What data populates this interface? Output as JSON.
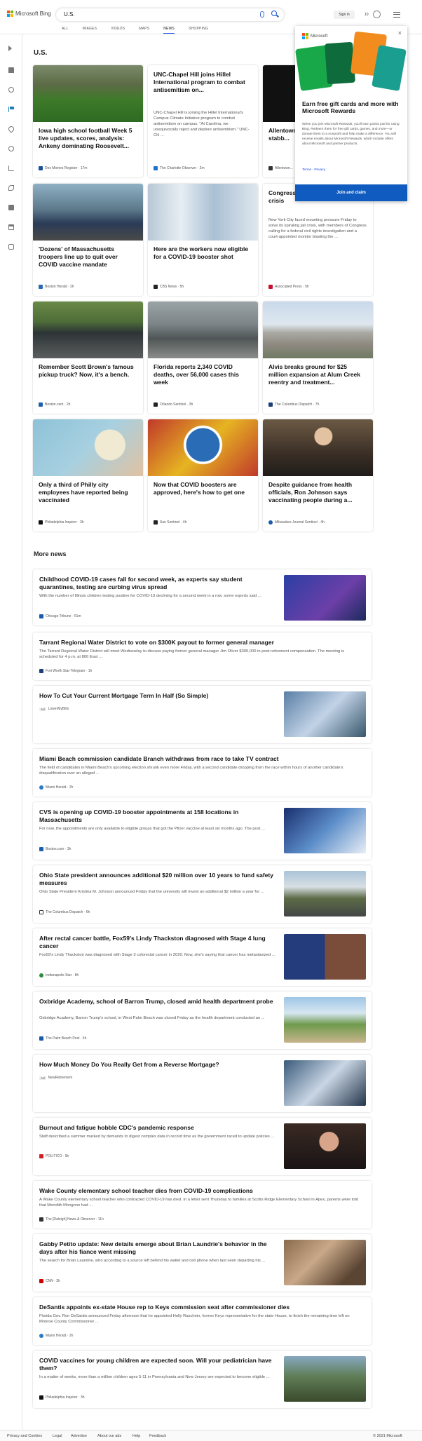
{
  "header": {
    "logo_text": "Microsoft Bing",
    "query": "U.S.",
    "signin": "Sign in",
    "points": "10"
  },
  "tabs": [
    "ALL",
    "IMAGES",
    "VIDEOS",
    "MAPS",
    "NEWS",
    "SHOPPING"
  ],
  "section_title": "U.S.",
  "popup": {
    "brand": "Microsoft",
    "close": "×",
    "heading": "Earn free gift cards and more with Microsoft Rewards",
    "body": "When you join Microsoft Rewards, you'll earn points just for using Bing. Redeem them for free gift cards, games, and more—or donate them to a nonprofit and help make a difference. You will receive emails about Microsoft Rewards, which include offers about Microsoft and partner products.",
    "terms": "Terms · Privacy",
    "button": "Join and claim"
  },
  "cards": [
    {
      "title": "Iowa high school football Week 5 live updates, scores, analysis: Ankeny dominating Roosevelt...",
      "source": "Des Moines Register · 17m"
    },
    {
      "title": "UNC-Chapel Hill joins Hillel International program to combat antisemitism on...",
      "desc": "UNC-Chapel Hill is joining the Hillel International's Campus Climate Initiative program to combat antisemitism on campus. \"At Carolina, we unequivocally reject and deplore antisemitism,\" UNC-CH ...",
      "source": "The Charlotte Observer · 2m"
    },
    {
      "title": "Allentown ... more tha... for stabb...",
      "source": "Allentown..."
    },
    {
      "title": "'Dozens' of Massachusetts troopers line up to quit over COVID vaccine mandate",
      "source": "Boston Herald · 2h"
    },
    {
      "title": "Here are the workers now eligible for a COVID-19 booster shot",
      "source": "CBS News · 5h"
    },
    {
      "title": "Congress ... York City to fix jails crisis",
      "desc": "New York City faced mounting pressure Friday to solve its spiraling jail crisis, with members of Congress calling for a federal civil rights investigation and a court-appointed monitor blasting the ...",
      "source": "Associated Press · 5h"
    },
    {
      "title": "Remember Scott Brown's famous pickup truck? Now, it's a bench.",
      "source": "Boston.com · 2h"
    },
    {
      "title": "Florida reports 2,340 COVID deaths, over 56,000 cases this week",
      "source": "Orlando Sentinel · 3h"
    },
    {
      "title": "Alvis breaks ground for $25 million expansion at Alum Creek reentry and treatment...",
      "source": "The Columbus Dispatch · 7h"
    },
    {
      "title": "Only a third of Philly city employees have reported being vaccinated",
      "source": "Philadelphia Inquirer · 3h"
    },
    {
      "title": "Now that COVID boosters are approved, here's how to get one",
      "source": "Sun Sentinel · 4h"
    },
    {
      "title": "Despite guidance from health officials, Ron Johnson says vaccinating people during a...",
      "source": "Milwaukee Journal Sentinel · 4h"
    }
  ],
  "more_news_title": "More news",
  "more_news": [
    {
      "title": "Childhood COVID-19 cases fall for second week, as experts say student quarantines, testing are curbing virus spread",
      "desc": "With the number of Illinois children testing positive for COVID-19 declining for a second week in a row, some experts said ...",
      "source": "Chicago Tribune · 51m"
    },
    {
      "title": "Tarrant Regional Water District to vote on $300K payout to former general manager",
      "desc": "The Tarrant Regional Water District will meet Wednesday to discuss paying former general manager Jim Oliver $300,000 in post-retirement compensation. The meeting is scheduled for 4 p.m. at 800 East ...",
      "source": "Fort Worth Star-Telegram · 1h"
    },
    {
      "title": "How To Cut Your Current Mortgage Term In Half (So Simple)",
      "ad": "Ad",
      "source": "LowerMyBills"
    },
    {
      "title": "Miami Beach commission candidate Branch withdraws from race to take TV contract",
      "desc": "The field of candidates in Miami Beach's upcoming election shrunk even more Friday, with a second candidate dropping from the race within hours of another candidate's disqualification over an alleged ...",
      "source": "Miami Herald · 2h"
    },
    {
      "title": "CVS is opening up COVID-19 booster appointments at 158 locations in Massachusetts",
      "desc": "For now, the appointments are only available to eligible groups that got the Pfizer vaccine at least six months ago. The post ...",
      "source": "Boston.com · 3h"
    },
    {
      "title": "Ohio State president announces additional $20 million over 10 years to fund safety measures",
      "desc": "Ohio State President Kristina M. Johnson announced Friday that the university will invest an additional $2 million a year for ...",
      "source": "The Columbus Dispatch · 6h"
    },
    {
      "title": "After rectal cancer battle, Fox59's Lindy Thackston diagnosed with Stage 4 lung cancer",
      "desc": "Fox59's Lindy Thackston was diagnosed with Stage 3 colorectal cancer in 2020. Now, she's saying that cancer has metastasized ...",
      "source": "Indianapolis Star · 8h"
    },
    {
      "title": "Oxbridge Academy, school of Barron Trump, closed amid health department probe",
      "desc": "Oxbridge Academy, Barron Trump's school, in West Palm Beach was closed Friday as the health department conducted an ...",
      "source": "The Palm Beach Post · 6h"
    },
    {
      "title": "How Much Money Do You Really Get from a Reverse Mortgage?",
      "ad": "Ad",
      "source": "NewRetirement"
    },
    {
      "title": "Burnout and fatigue hobble CDC's pandemic response",
      "desc": "Staff described a summer marked by demands to digest complex data in record time as the government raced to update policies ...",
      "source": "POLITICO · 9h"
    },
    {
      "title": "Wake County elementary school teacher dies from COVID-19 complications",
      "desc": "A Wake County elementary school teacher who contracted COVID-19 has died. In a letter sent Thursday to families at Scotts Ridge Elementary School in Apex, parents were told that Merrdith Mongone had ...",
      "source": "The [Raleigh] News & Observer · 11h"
    },
    {
      "title": "Gabby Petito update: New details emerge about Brian Laundrie's behavior in the days after his fiance went missing",
      "desc": "The search for Brian Laundrie, who according to a source left behind his wallet and cell phone when last seen departing his ...",
      "source": "CNN · 3h"
    },
    {
      "title": "DeSantis appoints ex-state House rep to Keys commission seat after commissioner dies",
      "desc": "Florida Gov. Ron DeSantis announced Friday afternoon that he appointed Holly Raschein, former Keys representative for the state House, to finish the remaining time left on Monroe County Commissioner ...",
      "source": "Miami Herald · 2h"
    },
    {
      "title": "COVID vaccines for young children are expected soon. Will your pediatrician have them?",
      "desc": "In a matter of weeks, more than a million children ages 5-11 in Pennsylvania and New Jersey are expected to become eligible ...",
      "source": "Philadelphia Inquirer · 3h"
    }
  ],
  "footer": {
    "links": [
      "Privacy and Cookies",
      "Legal",
      "Advertise",
      "About our ads",
      "Help",
      "Feedback"
    ],
    "copyright": "© 2021 Microsoft"
  }
}
